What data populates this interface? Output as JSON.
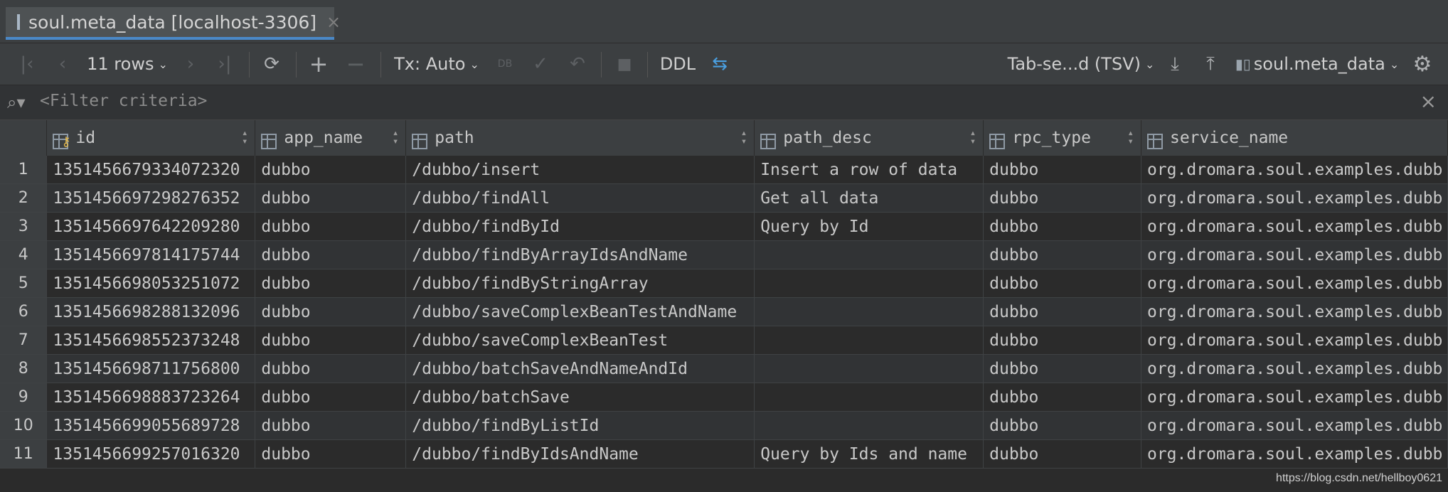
{
  "tab": {
    "title": "soul.meta_data [localhost-3306]",
    "close": "×"
  },
  "toolbar": {
    "first": "|‹",
    "prev": "‹",
    "rows": "11 rows",
    "next": "›",
    "last": "›|",
    "refresh": "⟳",
    "add": "+",
    "remove": "−",
    "tx": "Tx: Auto",
    "commit": "✓",
    "rollback": "↶",
    "stop": "■",
    "ddl": "DDL",
    "compare": "⇆",
    "format": "Tab-se...d (TSV)",
    "export": "⤓",
    "import": "⤒",
    "datasource": "soul.meta_data",
    "settings": "⚙"
  },
  "filter": {
    "placeholder": "<Filter criteria>",
    "close": "×",
    "search": "Q"
  },
  "columns": [
    {
      "name": "id",
      "key": true
    },
    {
      "name": "app_name"
    },
    {
      "name": "path"
    },
    {
      "name": "path_desc"
    },
    {
      "name": "rpc_type"
    },
    {
      "name": "service_name"
    }
  ],
  "rows": [
    {
      "n": "1",
      "id": "1351456679334072320",
      "app": "dubbo",
      "path": "/dubbo/insert",
      "desc": "Insert a row of data",
      "rpc": "dubbo",
      "svc": "org.dromara.soul.examples.dubb"
    },
    {
      "n": "2",
      "id": "1351456697298276352",
      "app": "dubbo",
      "path": "/dubbo/findAll",
      "desc": "Get all data",
      "rpc": "dubbo",
      "svc": "org.dromara.soul.examples.dubb"
    },
    {
      "n": "3",
      "id": "1351456697642209280",
      "app": "dubbo",
      "path": "/dubbo/findById",
      "desc": "Query by Id",
      "rpc": "dubbo",
      "svc": "org.dromara.soul.examples.dubb"
    },
    {
      "n": "4",
      "id": "1351456697814175744",
      "app": "dubbo",
      "path": "/dubbo/findByArrayIdsAndName",
      "desc": "",
      "rpc": "dubbo",
      "svc": "org.dromara.soul.examples.dubb"
    },
    {
      "n": "5",
      "id": "1351456698053251072",
      "app": "dubbo",
      "path": "/dubbo/findByStringArray",
      "desc": "",
      "rpc": "dubbo",
      "svc": "org.dromara.soul.examples.dubb"
    },
    {
      "n": "6",
      "id": "1351456698288132096",
      "app": "dubbo",
      "path": "/dubbo/saveComplexBeanTestAndName",
      "desc": "",
      "rpc": "dubbo",
      "svc": "org.dromara.soul.examples.dubb"
    },
    {
      "n": "7",
      "id": "1351456698552373248",
      "app": "dubbo",
      "path": "/dubbo/saveComplexBeanTest",
      "desc": "",
      "rpc": "dubbo",
      "svc": "org.dromara.soul.examples.dubb"
    },
    {
      "n": "8",
      "id": "1351456698711756800",
      "app": "dubbo",
      "path": "/dubbo/batchSaveAndNameAndId",
      "desc": "",
      "rpc": "dubbo",
      "svc": "org.dromara.soul.examples.dubb"
    },
    {
      "n": "9",
      "id": "1351456698883723264",
      "app": "dubbo",
      "path": "/dubbo/batchSave",
      "desc": "",
      "rpc": "dubbo",
      "svc": "org.dromara.soul.examples.dubb"
    },
    {
      "n": "10",
      "id": "1351456699055689728",
      "app": "dubbo",
      "path": "/dubbo/findByListId",
      "desc": "",
      "rpc": "dubbo",
      "svc": "org.dromara.soul.examples.dubb"
    },
    {
      "n": "11",
      "id": "1351456699257016320",
      "app": "dubbo",
      "path": "/dubbo/findByIdsAndName",
      "desc": "Query by Ids and name",
      "rpc": "dubbo",
      "svc": "org.dromara.soul.examples.dubb"
    }
  ],
  "watermark": "https://blog.csdn.net/hellboy0621"
}
